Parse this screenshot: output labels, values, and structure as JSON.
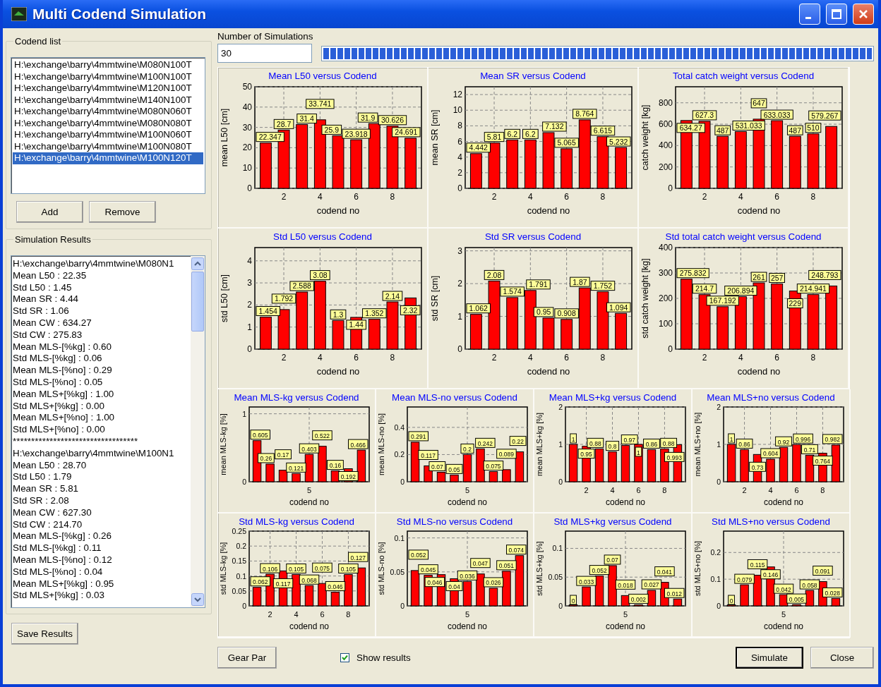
{
  "window": {
    "title": "Multi Codend Simulation"
  },
  "codend_list": {
    "label": "Codend list",
    "items": [
      {
        "text": "H:\\exchange\\barry\\4mmtwine\\M080N100T",
        "selected": false
      },
      {
        "text": "H:\\exchange\\barry\\4mmtwine\\M100N100T",
        "selected": false
      },
      {
        "text": "H:\\exchange\\barry\\4mmtwine\\M120N100T",
        "selected": false
      },
      {
        "text": "H:\\exchange\\barry\\4mmtwine\\M140N100T",
        "selected": false
      },
      {
        "text": "H:\\exchange\\barry\\4mmtwine\\M080N060T",
        "selected": false
      },
      {
        "text": "H:\\exchange\\barry\\4mmtwine\\M080N080T",
        "selected": false
      },
      {
        "text": "H:\\exchange\\barry\\4mmtwine\\M100N060T",
        "selected": false
      },
      {
        "text": "H:\\exchange\\barry\\4mmtwine\\M100N080T",
        "selected": false
      },
      {
        "text": "H:\\exchange\\barry\\4mmtwine\\M100N120T",
        "selected": true
      }
    ],
    "buttons": [
      "Add",
      "Remove"
    ]
  },
  "results": {
    "label": "Simulation Results",
    "lines": [
      "H:\\exchange\\barry\\4mmtwine\\M080N1",
      "Mean L50 :  22.35",
      "Std L50 :  1.45",
      "Mean SR :  4.44",
      "Std SR :  1.06",
      "Mean CW :  634.27",
      "Std CW :  275.83",
      "Mean MLS-[%kg] :  0.60",
      "Std MLS-[%kg] :  0.06",
      "Mean MLS-[%no] :  0.29",
      "Std MLS-[%no] :  0.05",
      "Mean MLS+[%kg] :  1.00",
      "Std MLS+[%kg] :  0.00",
      "Mean MLS+[%no] :  1.00",
      "Std MLS+[%no] :  0.00",
      "**********************************",
      "H:\\exchange\\barry\\4mmtwine\\M100N1",
      "Mean L50 :  28.70",
      "Std L50 :  1.79",
      "Mean SR :  5.81",
      "Std SR :  2.08",
      "Mean CW :  627.30",
      "Std CW :  214.70",
      "Mean MLS-[%kg] :  0.26",
      "Std MLS-[%kg] :  0.11",
      "Mean MLS-[%no] :  0.12",
      "Std MLS-[%no] :  0.04",
      "Mean MLS+[%kg] :  0.95",
      "Std MLS+[%kg] :  0.03"
    ],
    "save_button": "Save Results"
  },
  "simulations": {
    "label": "Number of Simulations",
    "value": "30",
    "progress": {
      "level": 1
    }
  },
  "charts": [
    {
      "chart_data": {
        "type": "bar",
        "title": "Mean L50 versus Codend",
        "xlabel": "codend no",
        "ylabel": "mean L50 [cm]",
        "x": [
          1,
          2,
          3,
          4,
          5,
          6,
          7,
          8,
          9
        ],
        "values": [
          22.347,
          28.7,
          31.4,
          33.741,
          25.9,
          23.918,
          31.9,
          30.626,
          24.691
        ],
        "xlim": [
          0.4,
          9.6
        ],
        "ylim": [
          0,
          50
        ],
        "xticks": [
          2,
          4,
          6,
          8
        ],
        "yticks": [
          0,
          10,
          20,
          30,
          40,
          50
        ],
        "grid": true,
        "data_labels": true
      }
    },
    {
      "chart_data": {
        "type": "bar",
        "title": "Mean SR versus Codend",
        "xlabel": "codend no",
        "ylabel": "mean SR [cm]",
        "x": [
          1,
          2,
          3,
          4,
          5,
          6,
          7,
          8,
          9
        ],
        "values": [
          4.442,
          5.81,
          6.2,
          6.2,
          7.132,
          5.065,
          8.764,
          6.615,
          5.232
        ],
        "xlim": [
          0.4,
          9.6
        ],
        "ylim": [
          0,
          13
        ],
        "xticks": [
          2,
          4,
          6,
          8
        ],
        "yticks": [
          0,
          2,
          4,
          6,
          8,
          10,
          12
        ],
        "grid": true,
        "data_labels": true
      }
    },
    {
      "chart_data": {
        "type": "bar",
        "title": "Total catch weight versus Codend",
        "xlabel": "codend no",
        "ylabel": "catch weight [kg]",
        "x": [
          1,
          2,
          3,
          4,
          5,
          6,
          7,
          8,
          9
        ],
        "values": [
          634.27,
          627.3,
          487,
          531.033,
          647,
          633.033,
          487,
          510,
          579.267
        ],
        "xlim": [
          0.4,
          9.6
        ],
        "ylim": [
          0,
          950
        ],
        "xticks": [
          2,
          4,
          6,
          8
        ],
        "yticks": [
          0,
          200,
          400,
          600,
          800
        ],
        "grid": true,
        "data_labels": true
      }
    },
    {
      "chart_data": {
        "type": "bar",
        "title": "Std L50 versus Codend",
        "xlabel": "codend no",
        "ylabel": "std L50 [cm]",
        "x": [
          1,
          2,
          3,
          4,
          5,
          6,
          7,
          8,
          9
        ],
        "values": [
          1.454,
          1.792,
          2.588,
          3.08,
          1.3,
          1.44,
          1.352,
          2.14,
          2.32
        ],
        "xlim": [
          0.4,
          9.6
        ],
        "ylim": [
          0,
          4.6
        ],
        "xticks": [
          2,
          4,
          6,
          8
        ],
        "yticks": [
          0,
          1,
          2,
          3,
          4
        ],
        "grid": true,
        "data_labels": true
      }
    },
    {
      "chart_data": {
        "type": "bar",
        "title": "Std SR versus Codend",
        "xlabel": "codend no",
        "ylabel": "std SR [cm]",
        "x": [
          1,
          2,
          3,
          4,
          5,
          6,
          7,
          8,
          9
        ],
        "values": [
          1.062,
          2.08,
          1.574,
          1.791,
          0.95,
          0.908,
          1.87,
          1.752,
          1.094
        ],
        "xlim": [
          0.4,
          9.6
        ],
        "ylim": [
          0,
          3.1
        ],
        "xticks": [
          2,
          4,
          6,
          8
        ],
        "yticks": [
          0,
          1,
          2,
          3
        ],
        "grid": true,
        "data_labels": true
      }
    },
    {
      "chart_data": {
        "type": "bar",
        "title": "Std total catch weight versus Codend",
        "xlabel": "codend no",
        "ylabel": "std catch weight [kg]",
        "x": [
          1,
          2,
          3,
          4,
          5,
          6,
          7,
          8,
          9
        ],
        "values": [
          275.832,
          214.7,
          167.192,
          206.894,
          261,
          257,
          229,
          214.941,
          248.793
        ],
        "xlim": [
          0.4,
          9.6
        ],
        "ylim": [
          0,
          400
        ],
        "xticks": [
          2,
          4,
          6,
          8
        ],
        "yticks": [
          0,
          100,
          200,
          300,
          400
        ],
        "grid": true,
        "data_labels": true
      }
    },
    {
      "chart_data": {
        "type": "bar",
        "title": "Mean MLS-kg versus Codend",
        "xlabel": "codend no",
        "ylabel": "mean MLS-kg [%]",
        "values": [
          0.605,
          0.26,
          0.17,
          0.121,
          0.403,
          0.522,
          0.16,
          0.192,
          0.466
        ],
        "annotations": [
          {
            "text": "5"
          }
        ],
        "ylim": [
          0,
          1.1
        ],
        "yticks": [
          0,
          1
        ],
        "grid": true,
        "data_labels": true
      }
    },
    {
      "chart_data": {
        "type": "bar",
        "title": "Mean MLS-no versus Codend",
        "xlabel": "codend no",
        "ylabel": "mean MLS-no [%]",
        "values": [
          0.291,
          0.117,
          0.07,
          0.05,
          0.2,
          0.242,
          0.075,
          0.089,
          0.22
        ],
        "annotations": [
          {
            "text": "5"
          }
        ],
        "ylim": [
          0,
          0.55
        ],
        "yticks": [
          0,
          0.2,
          0.4
        ],
        "grid": true,
        "data_labels": true
      }
    },
    {
      "chart_data": {
        "type": "bar",
        "title": "Mean MLS+kg versus Codend",
        "xlabel": "codend no",
        "ylabel": "mean MLS+kg [%]",
        "x": [
          1,
          2,
          3,
          4,
          5,
          6,
          7,
          8,
          9
        ],
        "values": [
          1,
          0.95,
          0.88,
          0.8,
          0.97,
          1,
          0.86,
          0.88,
          0.993
        ],
        "xlim": [
          0.4,
          9.6
        ],
        "ylim": [
          0,
          2
        ],
        "xticks": [
          2,
          4,
          6,
          8
        ],
        "yticks": [
          0,
          1,
          2
        ],
        "grid": true,
        "data_labels": true
      }
    },
    {
      "chart_data": {
        "type": "bar",
        "title": "Mean MLS+no versus Codend",
        "xlabel": "codend no",
        "ylabel": "mean MLS+no [%]",
        "x": [
          1,
          2,
          3,
          4,
          5,
          6,
          7,
          8,
          9
        ],
        "values": [
          1,
          0.86,
          0.73,
          0.604,
          0.92,
          0.996,
          0.71,
          0.764,
          0.982
        ],
        "xlim": [
          0.4,
          9.6
        ],
        "ylim": [
          0,
          2
        ],
        "xticks": [
          2,
          4,
          6,
          8
        ],
        "yticks": [
          0,
          1,
          2
        ],
        "grid": true,
        "data_labels": true
      }
    },
    {
      "chart_data": {
        "type": "bar",
        "title": "Std MLS-kg versus Codend",
        "xlabel": "codend no",
        "ylabel": "std MLS-kg [%]",
        "x": [
          1,
          2,
          3,
          4,
          5,
          6,
          7,
          8,
          9
        ],
        "values": [
          0.062,
          0.106,
          0.117,
          0.105,
          0.068,
          0.075,
          0.046,
          0.105,
          0.127
        ],
        "xlim": [
          0.4,
          9.6
        ],
        "ylim": [
          0,
          0.25
        ],
        "xticks": [
          2,
          4,
          6,
          8
        ],
        "yticks": [
          0,
          0.05,
          0.1,
          0.15,
          0.2,
          0.25
        ],
        "grid": true,
        "data_labels": true
      }
    },
    {
      "chart_data": {
        "type": "bar",
        "title": "Std MLS-no versus Codend",
        "xlabel": "codend no",
        "ylabel": "std MLS-no [%]",
        "values": [
          0.052,
          0.045,
          0.046,
          0.04,
          0.036,
          0.047,
          0.026,
          0.051,
          0.074
        ],
        "annotations": [
          {
            "text": "5"
          }
        ],
        "ylim": [
          0,
          0.11
        ],
        "yticks": [
          0,
          0.05,
          0.1
        ],
        "grid": true,
        "data_labels": true
      }
    },
    {
      "chart_data": {
        "type": "bar",
        "title": "Std MLS+kg versus Codend",
        "xlabel": "codend no",
        "ylabel": "std MLS+kg [%]",
        "values": [
          0,
          0.033,
          0.052,
          0.07,
          0.018,
          0.002,
          0.027,
          0.041,
          0.012
        ],
        "annotations": [
          {
            "text": "5"
          }
        ],
        "ylim": [
          0,
          0.13
        ],
        "yticks": [
          0,
          0.05,
          0.1
        ],
        "grid": true,
        "data_labels": true
      }
    },
    {
      "chart_data": {
        "type": "bar",
        "title": "Std MLS+no versus Codend",
        "xlabel": "codend no",
        "ylabel": "std MLS+no [%]",
        "values": [
          0,
          0.079,
          0.115,
          0.146,
          0.042,
          0.005,
          0.058,
          0.091,
          0.028
        ],
        "annotations": [
          {
            "text": "5"
          }
        ],
        "ylim": [
          0,
          0.28
        ],
        "yticks": [
          0,
          0.1,
          0.2
        ],
        "grid": true,
        "data_labels": true
      }
    }
  ],
  "gear_button": "Gear Par",
  "show_results": {
    "label": "Show results",
    "checked": true
  },
  "actions": [
    "Simulate",
    "Close"
  ]
}
